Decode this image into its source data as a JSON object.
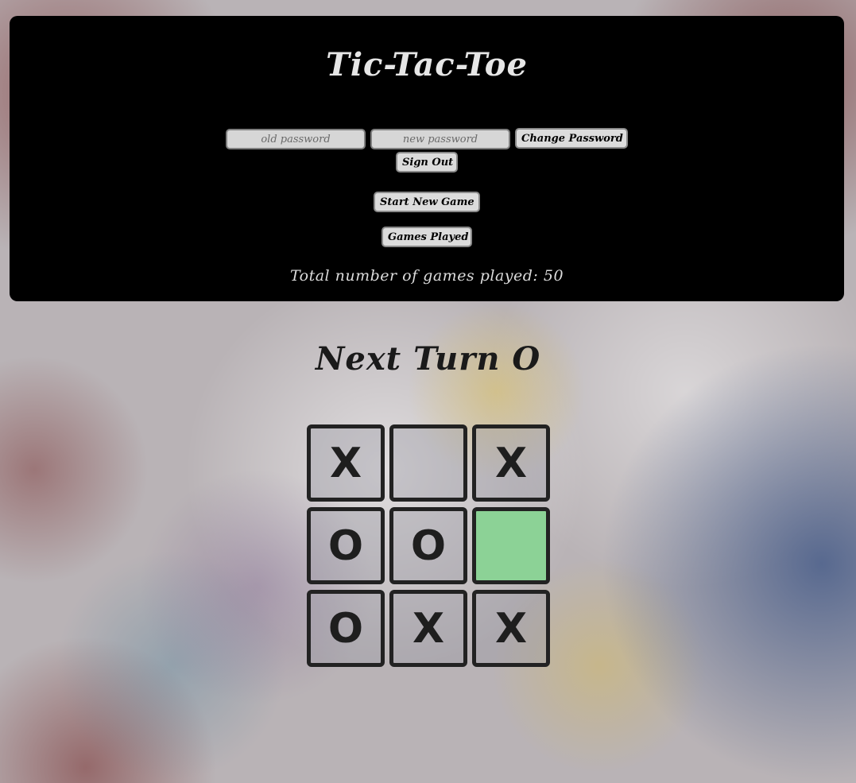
{
  "header": {
    "title": "Tic-Tac-Toe",
    "old_password_placeholder": "old password",
    "new_password_placeholder": "new password",
    "change_password_label": "Change Password",
    "sign_out_label": "Sign Out",
    "start_new_game_label": "Start New Game",
    "games_played_label": "Games Played",
    "games_total_text": "Total number of games played: 50"
  },
  "game": {
    "next_turn_text": "Next Turn O",
    "cells": [
      "X",
      "",
      "X",
      "O",
      "O",
      "",
      "O",
      "X",
      "X"
    ],
    "highlight_color": "#8cd296"
  }
}
